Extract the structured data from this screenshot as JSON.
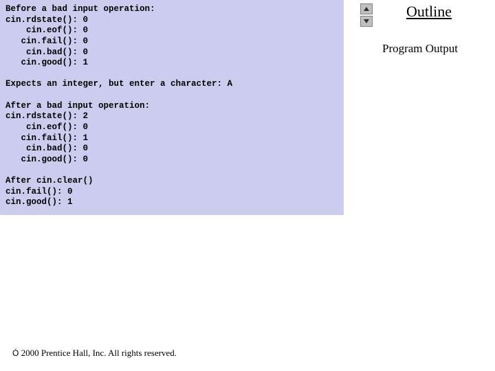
{
  "sidebar": {
    "outline_title": "Outline",
    "section_label": "Program Output"
  },
  "code": {
    "block1_header": "Before a bad input operation:",
    "block1_lines": [
      "cin.rdstate(): 0",
      "    cin.eof(): 0",
      "   cin.fail(): 0",
      "    cin.bad(): 0",
      "   cin.good(): 1"
    ],
    "prompt_line": "Expects an integer, but enter a character: A",
    "block2_header": "After a bad input operation:",
    "block2_lines": [
      "cin.rdstate(): 2",
      "    cin.eof(): 0",
      "   cin.fail(): 1",
      "    cin.bad(): 0",
      "   cin.good(): 0"
    ],
    "block3_header": "After cin.clear()",
    "block3_lines": [
      "cin.fail(): 0",
      "cin.good(): 1"
    ]
  },
  "footer": {
    "copyright": "2000 Prentice Hall, Inc. All rights reserved."
  }
}
